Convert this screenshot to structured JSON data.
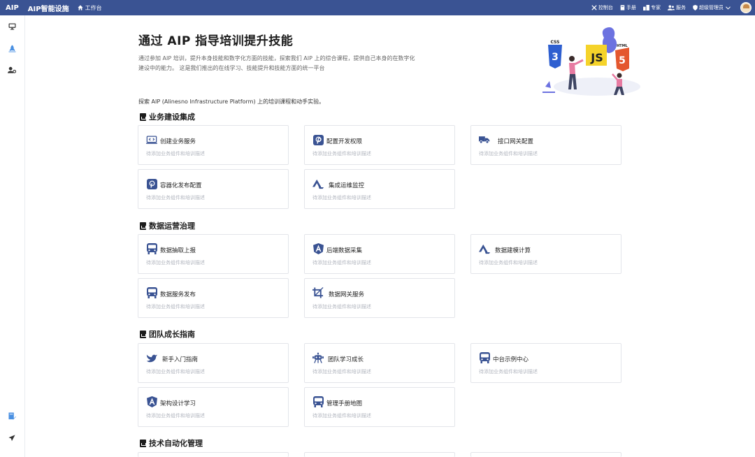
{
  "header": {
    "brand": "AIP",
    "app_name": "AIP智能设施",
    "home_label": "工作台",
    "nav": [
      {
        "label": "控制台",
        "icon": "tools-icon"
      },
      {
        "label": "手册",
        "icon": "book-icon"
      },
      {
        "label": "专家",
        "icon": "expert-icon"
      },
      {
        "label": "服务",
        "icon": "users-icon"
      },
      {
        "label": "超级管理员",
        "icon": "shield-icon"
      }
    ]
  },
  "sidebar": {
    "items": [
      {
        "icon": "monitor-icon"
      },
      {
        "icon": "rocket-icon"
      },
      {
        "icon": "user-cog-icon"
      },
      {
        "icon": "book-edit-icon"
      },
      {
        "icon": "send-icon"
      }
    ]
  },
  "hero": {
    "title": "通过 AIP 指导培训提升技能",
    "description": "通过参加 AIP 培训，提升本身技能和数字化方面的技能，探索我们 AIP 上的综合课程，提供自己本身的在数字化建设中的能力。 这是我们推出的在线学习、技能提升和技能方面的统一平台",
    "illustration_labels": [
      "CSS",
      "JS",
      "HTML"
    ]
  },
  "intro": "探索 AIP (Alinesno Infrastructure Platform) 上的培训课程和动手实验。",
  "sections": [
    {
      "title": "业务建设集成",
      "cards": [
        {
          "title": "创建业务服务",
          "desc": "待添加业务组件和培训描述",
          "icon": "laptop-code-icon"
        },
        {
          "title": "配置开发权限",
          "desc": "待添加业务组件和培训描述",
          "icon": "pinterest-icon"
        },
        {
          "title": "接口网关配置",
          "desc": "待添加业务组件和培训描述",
          "icon": "truck-icon"
        },
        {
          "title": "容器化发布配置",
          "desc": "待添加业务组件和培训描述",
          "icon": "pinterest-icon"
        },
        {
          "title": "集成运维监控",
          "desc": "待添加业务组件和培训描述",
          "icon": "triangle-logo-icon"
        }
      ]
    },
    {
      "title": "数据运营治理",
      "cards": [
        {
          "title": "数据抽取上报",
          "desc": "待添加业务组件和培训描述",
          "icon": "bus-icon"
        },
        {
          "title": "后端数据采集",
          "desc": "待添加业务组件和培训描述",
          "icon": "angular-icon"
        },
        {
          "title": "数据建模计算",
          "desc": "待添加业务组件和培训描述",
          "icon": "triangle-logo-icon"
        },
        {
          "title": "数据服务发布",
          "desc": "待添加业务组件和培训描述",
          "icon": "bus-icon"
        },
        {
          "title": "数据网关服务",
          "desc": "待添加业务组件和培训描述",
          "icon": "crop-icon"
        }
      ]
    },
    {
      "title": "团队成长指南",
      "cards": [
        {
          "title": "新手入门指南",
          "desc": "待添加业务组件和培训描述",
          "icon": "bird-icon"
        },
        {
          "title": "团队学习成长",
          "desc": "待添加业务组件和培训描述",
          "icon": "robot-icon"
        },
        {
          "title": "中台示例中心",
          "desc": "待添加业务组件和培训描述",
          "icon": "bus-icon"
        },
        {
          "title": "架构设计学习",
          "desc": "待添加业务组件和培训描述",
          "icon": "angular-icon"
        },
        {
          "title": "管理手册地图",
          "desc": "待添加业务组件和培训描述",
          "icon": "bus-icon"
        }
      ]
    },
    {
      "title": "技术自动化管理",
      "cards": [
        {
          "title": "",
          "desc": "",
          "icon": ""
        },
        {
          "title": "",
          "desc": "",
          "icon": ""
        },
        {
          "title": "",
          "desc": "",
          "icon": ""
        }
      ]
    }
  ],
  "colors": {
    "header_bg": "#3a5393",
    "icon_blue": "#3a5393",
    "sidebar_accent": "#4a90e2"
  }
}
